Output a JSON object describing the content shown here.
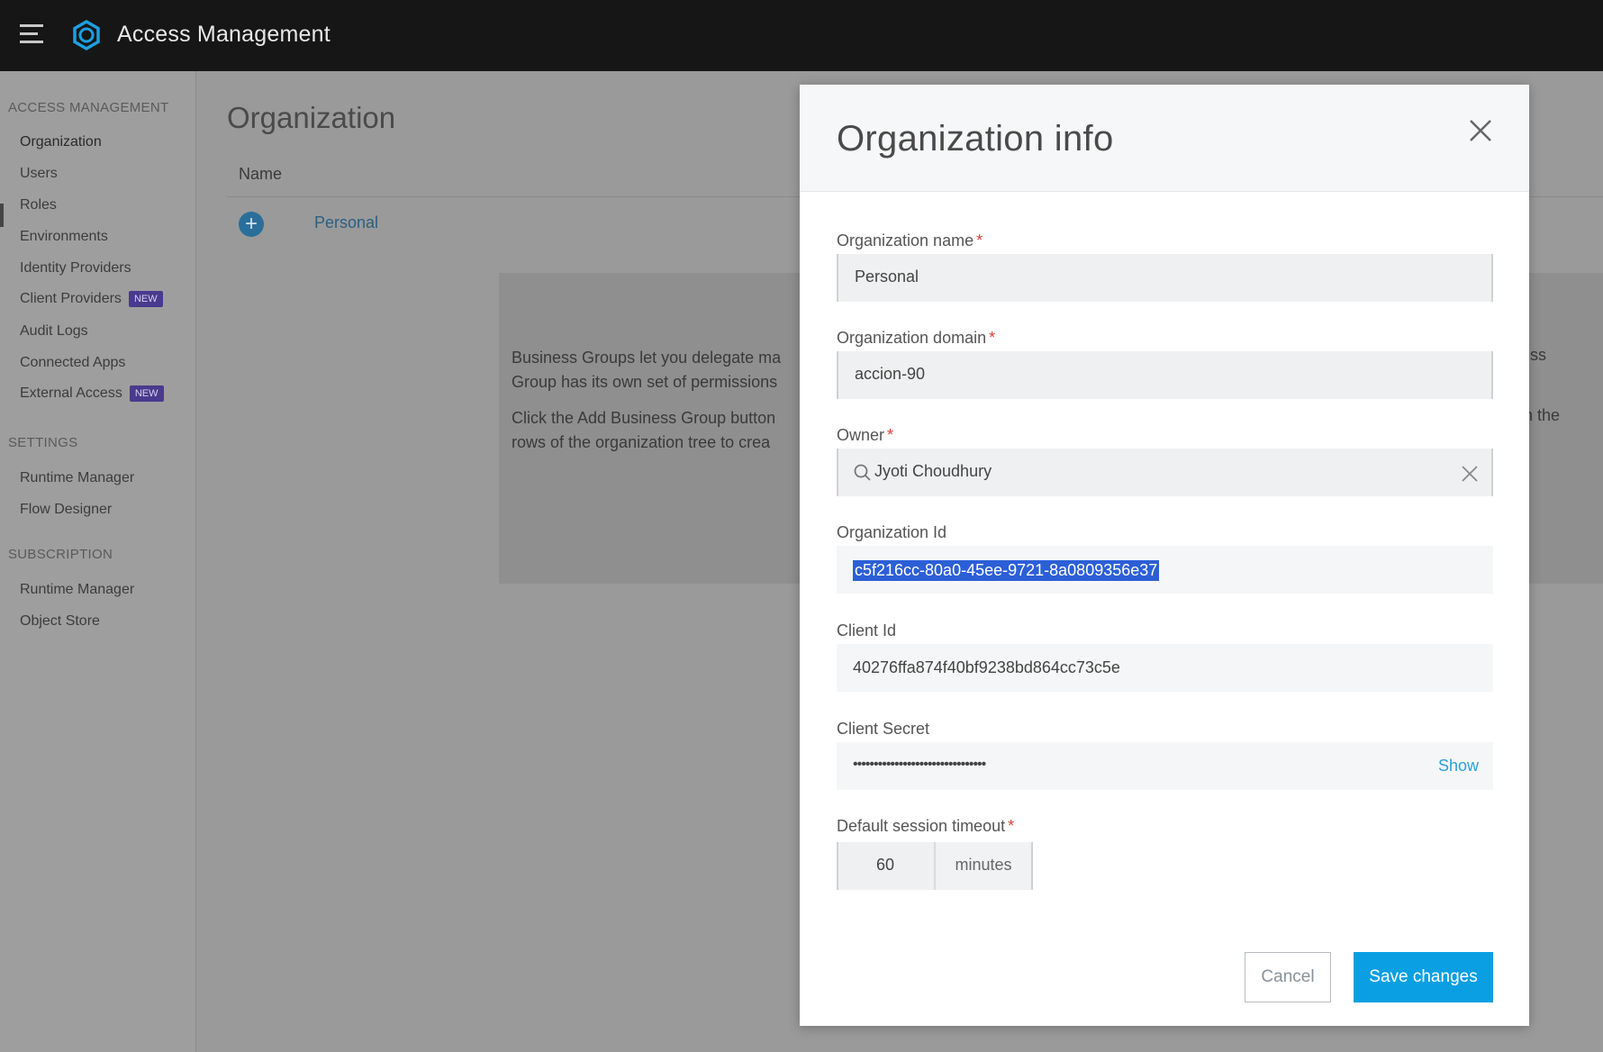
{
  "app": {
    "title": "Access Management",
    "accent_color": "#0a9fe2",
    "topbar_color": "#161616"
  },
  "sidebar": {
    "sections": [
      {
        "heading": "ACCESS MANAGEMENT",
        "items": [
          {
            "label": "Organization",
            "active": true
          },
          {
            "label": "Users"
          },
          {
            "label": "Roles"
          },
          {
            "label": "Environments"
          },
          {
            "label": "Identity Providers"
          },
          {
            "label": "Client Providers",
            "badge": "NEW"
          },
          {
            "label": "Audit Logs"
          },
          {
            "label": "Connected Apps"
          },
          {
            "label": "External Access",
            "badge": "NEW"
          }
        ]
      },
      {
        "heading": "SETTINGS",
        "items": [
          {
            "label": "Runtime Manager"
          },
          {
            "label": "Flow Designer"
          }
        ]
      },
      {
        "heading": "SUBSCRIPTION",
        "items": [
          {
            "label": "Runtime Manager"
          },
          {
            "label": "Object Store"
          }
        ]
      }
    ]
  },
  "main": {
    "page_title": "Organization",
    "column_name": "Name",
    "org_row": "Personal",
    "info_lines": [
      "Business Groups let you delegate ma",
      "Group has its own set of permissions",
      "Click the Add Business Group button",
      "rows of the organization tree to crea"
    ],
    "info_right": [
      "ss",
      "n the"
    ]
  },
  "modal": {
    "title": "Organization info",
    "fields": {
      "org_name": {
        "label": "Organization name",
        "value": "Personal",
        "required": "*"
      },
      "org_domain": {
        "label": "Organization domain",
        "value": "accion-90",
        "required": "*"
      },
      "owner": {
        "label": "Owner",
        "value": "Jyoti Choudhury",
        "required": "*"
      },
      "org_id": {
        "label": "Organization Id",
        "value": "c5f216cc-80a0-45ee-9721-8a0809356e37"
      },
      "client_id": {
        "label": "Client Id",
        "value": "40276ffa874f40bf9238bd864cc73c5e"
      },
      "client_secret": {
        "label": "Client Secret",
        "value": "••••••••••••••••••••••••••••••••",
        "show_label": "Show"
      },
      "session_timeout": {
        "label": "Default session timeout",
        "value": "60",
        "unit": "minutes",
        "required": "*"
      }
    },
    "buttons": {
      "cancel": "Cancel",
      "save": "Save changes"
    }
  }
}
